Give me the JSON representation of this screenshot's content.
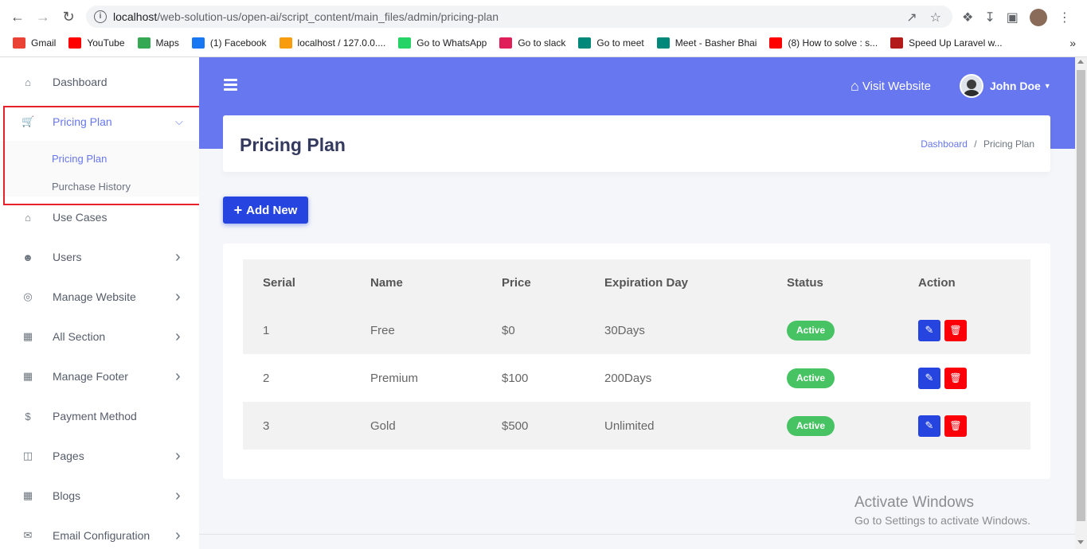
{
  "browser": {
    "url_host": "localhost",
    "url_path": "/web-solution-us/open-ai/script_content/main_files/admin/pricing-plan",
    "bookmarks": [
      {
        "label": "Gmail",
        "icon": "gmail-icon",
        "color": "#ea4335"
      },
      {
        "label": "YouTube",
        "icon": "youtube-icon",
        "color": "#ff0000"
      },
      {
        "label": "Maps",
        "icon": "maps-icon",
        "color": "#34a853"
      },
      {
        "label": "(1) Facebook",
        "icon": "facebook-icon",
        "color": "#1877f2"
      },
      {
        "label": "localhost / 127.0.0....",
        "icon": "phpmyadmin-icon",
        "color": "#f89c0e"
      },
      {
        "label": "Go to WhatsApp",
        "icon": "whatsapp-icon",
        "color": "#25d366"
      },
      {
        "label": "Go to slack",
        "icon": "slack-icon",
        "color": "#e01e5a"
      },
      {
        "label": "Go to meet",
        "icon": "meet-icon",
        "color": "#00897b"
      },
      {
        "label": "Meet - Basher Bhai",
        "icon": "meet-icon",
        "color": "#00897b"
      },
      {
        "label": "(8) How to solve : s...",
        "icon": "youtube-icon",
        "color": "#ff0000"
      },
      {
        "label": "Speed Up Laravel w...",
        "icon": "laravel-icon",
        "color": "#b31b1b"
      }
    ]
  },
  "sidebar": {
    "items": [
      {
        "label": "Dashboard",
        "icon": "home-icon",
        "chevron": false
      },
      {
        "label": "Pricing Plan",
        "icon": "cart-icon",
        "chevron": true
      },
      {
        "label": "Use Cases",
        "icon": "home-icon",
        "chevron": false
      },
      {
        "label": "Users",
        "icon": "users-icon",
        "chevron": true
      },
      {
        "label": "Manage Website",
        "icon": "globe-icon",
        "chevron": true
      },
      {
        "label": "All Section",
        "icon": "grid-icon",
        "chevron": true
      },
      {
        "label": "Manage Footer",
        "icon": "grid-icon",
        "chevron": true
      },
      {
        "label": "Payment Method",
        "icon": "dollar-icon",
        "chevron": false
      },
      {
        "label": "Pages",
        "icon": "columns-icon",
        "chevron": true
      },
      {
        "label": "Blogs",
        "icon": "grid-icon",
        "chevron": true
      },
      {
        "label": "Email Configuration",
        "icon": "envelope-icon",
        "chevron": true
      }
    ],
    "submenu": [
      {
        "label": "Pricing Plan"
      },
      {
        "label": "Purchase History"
      }
    ]
  },
  "header": {
    "visit_label": "Visit Website",
    "user_name": "John Doe"
  },
  "page": {
    "title": "Pricing Plan",
    "breadcrumb_home": "Dashboard",
    "breadcrumb_sep": "/",
    "breadcrumb_current": "Pricing Plan",
    "add_label": "Add New"
  },
  "table": {
    "headers": [
      "Serial",
      "Name",
      "Price",
      "Expiration Day",
      "Status",
      "Action"
    ],
    "rows": [
      {
        "serial": "1",
        "name": "Free",
        "price": "$0",
        "expiration": "30Days",
        "status": "Active"
      },
      {
        "serial": "2",
        "name": "Premium",
        "price": "$100",
        "expiration": "200Days",
        "status": "Active"
      },
      {
        "serial": "3",
        "name": "Gold",
        "price": "$500",
        "expiration": "Unlimited",
        "status": "Active"
      }
    ]
  },
  "watermark": {
    "line1": "Activate Windows",
    "line2": "Go to Settings to activate Windows."
  },
  "colors": {
    "primary": "#6777ef",
    "button": "#2644e0",
    "danger": "#fc000a",
    "success": "#47c363",
    "highlight_box": "#e8202a"
  }
}
